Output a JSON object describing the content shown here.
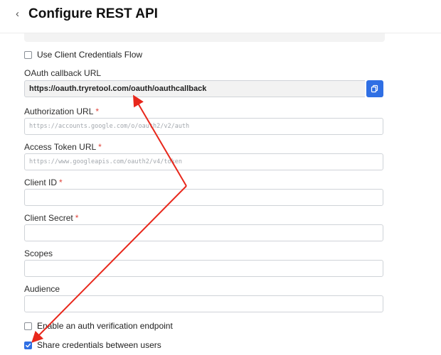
{
  "header": {
    "back_glyph": "‹",
    "title": "Configure REST API"
  },
  "client_credentials": {
    "label": "Use Client Credentials Flow",
    "checked": false
  },
  "oauth_callback": {
    "label": "OAuth callback URL",
    "value": "https://oauth.tryretool.com/oauth/oauthcallback"
  },
  "authorization_url": {
    "label": "Authorization URL",
    "required": "*",
    "placeholder": "https://accounts.google.com/o/oauth2/v2/auth"
  },
  "access_token_url": {
    "label": "Access Token URL",
    "required": "*",
    "placeholder": "https://www.googleapis.com/oauth2/v4/token"
  },
  "client_id": {
    "label": "Client ID",
    "required": "*",
    "value": ""
  },
  "client_secret": {
    "label": "Client Secret",
    "required": "*",
    "value": ""
  },
  "scopes": {
    "label": "Scopes",
    "value": ""
  },
  "audience": {
    "label": "Audience",
    "value": ""
  },
  "auth_verification": {
    "label": "Enable an auth verification endpoint",
    "checked": false
  },
  "share_credentials": {
    "label": "Share credentials between users",
    "checked": true
  },
  "colors": {
    "accent": "#2f6fe4",
    "required": "#e0433a",
    "annotation": "#e8271b"
  }
}
